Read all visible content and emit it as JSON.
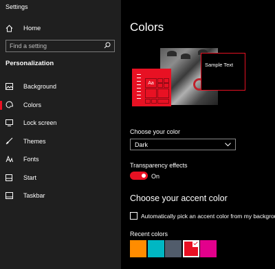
{
  "app": {
    "title": "Settings"
  },
  "sidebar": {
    "home_label": "Home",
    "search_placeholder": "Find a setting",
    "section_title": "Personalization",
    "items": [
      {
        "label": "Background",
        "icon": "image-icon"
      },
      {
        "label": "Colors",
        "icon": "palette-icon",
        "active": true
      },
      {
        "label": "Lock screen",
        "icon": "lock-screen-icon"
      },
      {
        "label": "Themes",
        "icon": "brush-icon"
      },
      {
        "label": "Fonts",
        "icon": "font-icon"
      },
      {
        "label": "Start",
        "icon": "start-icon"
      },
      {
        "label": "Taskbar",
        "icon": "taskbar-icon"
      }
    ]
  },
  "main": {
    "title": "Colors",
    "preview": {
      "sample_text": "Sample Text",
      "tile_text": "Aa"
    },
    "choose_color": {
      "label": "Choose your color",
      "value": "Dark"
    },
    "transparency": {
      "label": "Transparency effects",
      "state": "On"
    },
    "accent": {
      "title": "Choose your accent color",
      "auto_pick_label": "Automatically pick an accent color from my background",
      "recent_label": "Recent colors",
      "recent_colors": [
        "#ff8c00",
        "#00b7c3",
        "#515c6b",
        "#e81123",
        "#e3008c"
      ],
      "selected_index": 3
    }
  },
  "colors": {
    "accent": "#e81123",
    "sidebar_bg": "#1f1f1f",
    "main_bg": "#000000"
  }
}
